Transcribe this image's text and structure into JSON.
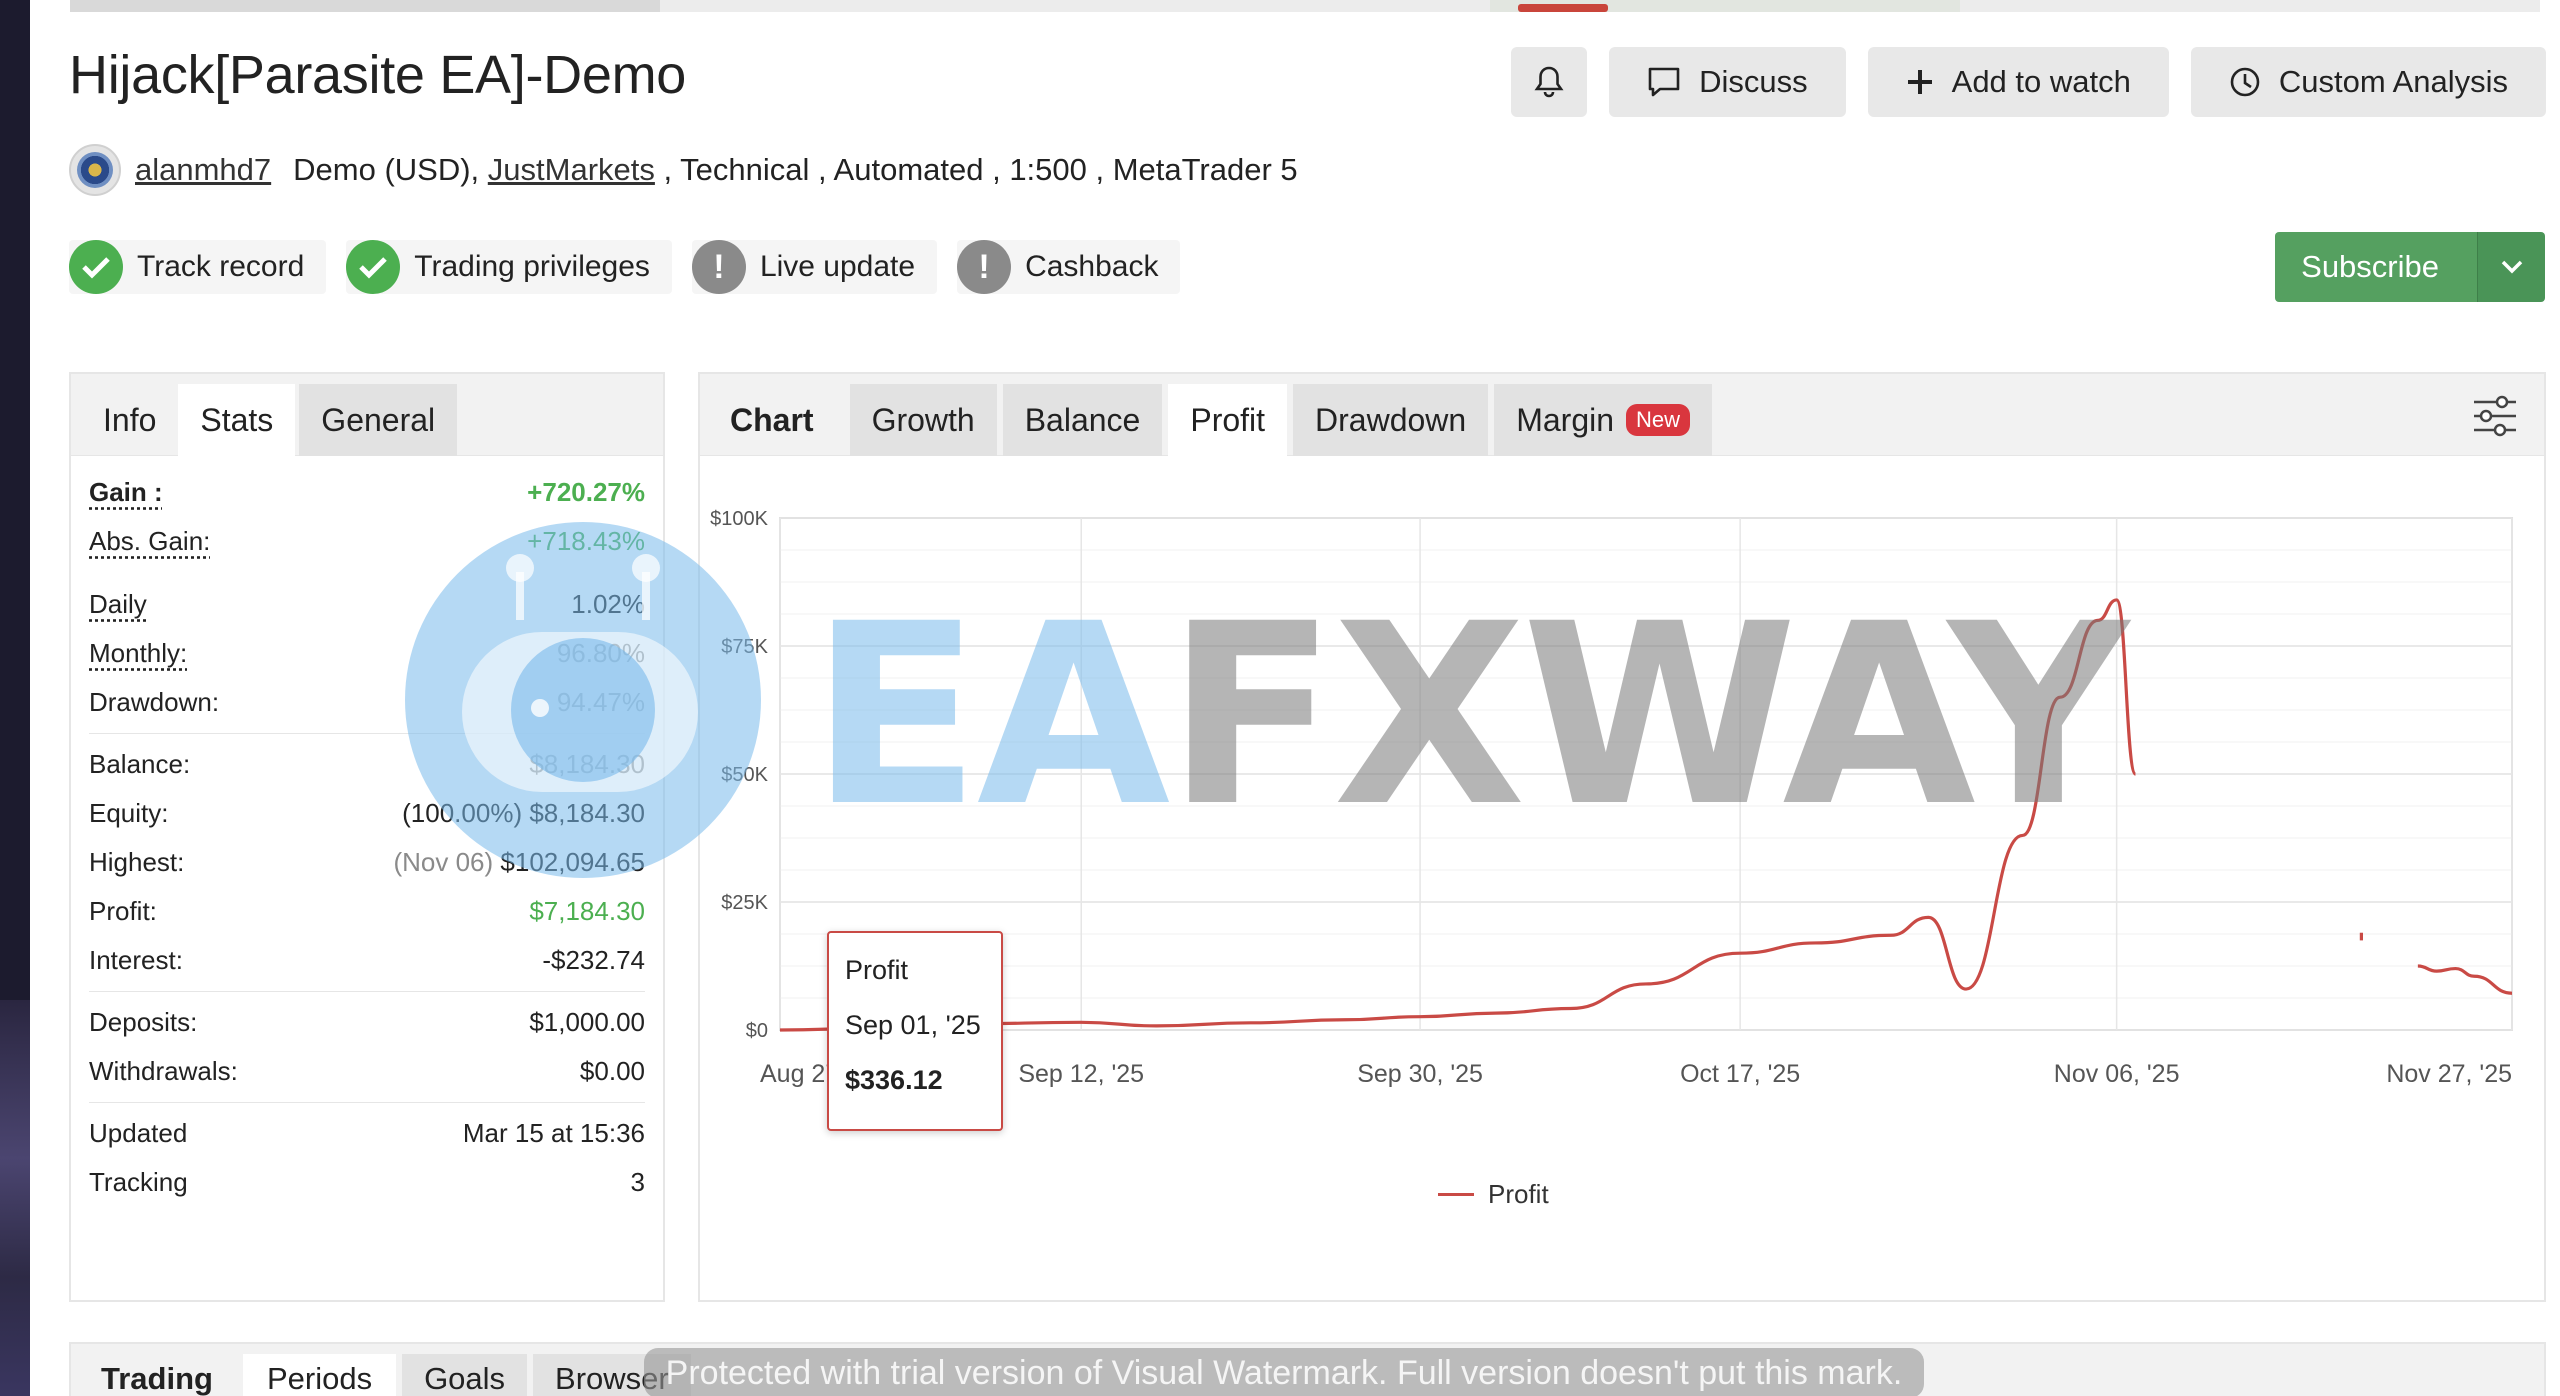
{
  "page": {
    "title": "Hijack[Parasite EA]-Demo"
  },
  "actions": {
    "discuss": "Discuss",
    "add_to_watch": "Add to watch",
    "custom_analysis": "Custom Analysis",
    "icons": [
      "bell-icon",
      "speech-bubble-icon",
      "plus-icon",
      "clock-icon"
    ]
  },
  "meta": {
    "author": "alanmhd7",
    "account_type": "Demo (USD), ",
    "broker": "JustMarkets",
    "details": " , Technical , Automated , 1:500 , MetaTrader 5"
  },
  "badges": [
    {
      "label": "Track record",
      "status": "ok"
    },
    {
      "label": "Trading privileges",
      "status": "ok"
    },
    {
      "label": "Live update",
      "status": "warning"
    },
    {
      "label": "Cashback",
      "status": "warning"
    }
  ],
  "subscribe": {
    "label": "Subscribe"
  },
  "info_panel": {
    "tabs": [
      "Info",
      "Stats",
      "General"
    ],
    "active_tab": "Stats",
    "stats": {
      "gain_label": "Gain :",
      "gain_value": "+720.27%",
      "abs_gain_label": "Abs. Gain:",
      "abs_gain_value": "+718.43%",
      "daily_label": "Daily",
      "daily_value": "1.02%",
      "monthly_label": "Monthly:",
      "monthly_value": "96.80%",
      "drawdown_label": "Drawdown:",
      "drawdown_value": "94.47%",
      "balance_label": "Balance:",
      "balance_value": "$8,184.30",
      "equity_label": "Equity:",
      "equity_value": "(100.00%) $8,184.30",
      "highest_label": "Highest:",
      "highest_date": "(Nov 06)",
      "highest_value": "$102,094.65",
      "profit_label": "Profit:",
      "profit_value": "$7,184.30",
      "interest_label": "Interest:",
      "interest_value": "-$232.74",
      "deposits_label": "Deposits:",
      "deposits_value": "$1,000.00",
      "withdrawals_label": "Withdrawals:",
      "withdrawals_value": "$0.00",
      "updated_label": "Updated",
      "updated_value": "Mar 15 at 15:36",
      "tracking_label": "Tracking",
      "tracking_value": "3"
    }
  },
  "chart_panel": {
    "tabs": [
      "Chart",
      "Growth",
      "Balance",
      "Profit",
      "Drawdown",
      "Margin"
    ],
    "active_tab": "Profit",
    "new_badge": "New",
    "tooltip": {
      "series": "Profit",
      "date": "Sep 01, '25",
      "value": "$336.12"
    }
  },
  "chart_data": {
    "type": "line",
    "title": "",
    "xlabel": "",
    "ylabel": "",
    "x_ticks": [
      "Aug 27, '25",
      "Sep 12, '25",
      "Sep 30, '25",
      "Oct 17, '25",
      "Nov 06, '25",
      "Nov 27, '25"
    ],
    "y_ticks": [
      "$0",
      "$25K",
      "$50K",
      "$75K",
      "$100K"
    ],
    "ylim": [
      0,
      100000
    ],
    "grid": true,
    "legend_position": "bottom",
    "series": [
      {
        "name": "Profit",
        "color": "#c94a45",
        "points": [
          [
            "Aug 27, '25",
            0
          ],
          [
            "Sep 01, '25",
            336
          ],
          [
            "Sep 06, '25",
            1200
          ],
          [
            "Sep 12, '25",
            1500
          ],
          [
            "Sep 16, '25",
            800
          ],
          [
            "Sep 21, '25",
            1400
          ],
          [
            "Sep 26, '25",
            2000
          ],
          [
            "Sep 30, '25",
            2600
          ],
          [
            "Oct 04, '25",
            3300
          ],
          [
            "Oct 08, '25",
            4200
          ],
          [
            "Oct 12, '25",
            9000
          ],
          [
            "Oct 17, '25",
            15000
          ],
          [
            "Oct 21, '25",
            17000
          ],
          [
            "Oct 25, '25",
            18500
          ],
          [
            "Oct 27, '25",
            22000
          ],
          [
            "Oct 29, '25",
            8000
          ],
          [
            "Nov 01, '25",
            38000
          ],
          [
            "Nov 03, '25",
            65000
          ],
          [
            "Nov 05, '25",
            80000
          ],
          [
            "Nov 06, '25",
            84000
          ],
          [
            "Nov 07, '25",
            50000
          ]
        ]
      },
      {
        "name": "Profit",
        "color": "#c94a45",
        "points": [
          [
            "Nov 19, '25",
            19000
          ],
          [
            "Nov 19, '25",
            17500
          ]
        ]
      },
      {
        "name": "Profit",
        "color": "#c94a45",
        "points": [
          [
            "Nov 22, '25",
            12500
          ],
          [
            "Nov 23, '25",
            11500
          ],
          [
            "Nov 24, '25",
            12000
          ],
          [
            "Nov 25, '25",
            10500
          ],
          [
            "Nov 27, '25",
            7184
          ]
        ]
      }
    ]
  },
  "watermark": {
    "brand_blue": "EA",
    "brand_grey": "FXWAY",
    "trial_notice": "Protected with trial version of Visual Watermark. Full version doesn't put this mark."
  },
  "bottom_panel": {
    "tabs": [
      "Trading",
      "Periods",
      "Goals",
      "Browser"
    ]
  },
  "colors": {
    "green": "#4caf50",
    "subscribe": "#55a060",
    "chart_line": "#c94a45",
    "new_badge": "#d9363e"
  }
}
